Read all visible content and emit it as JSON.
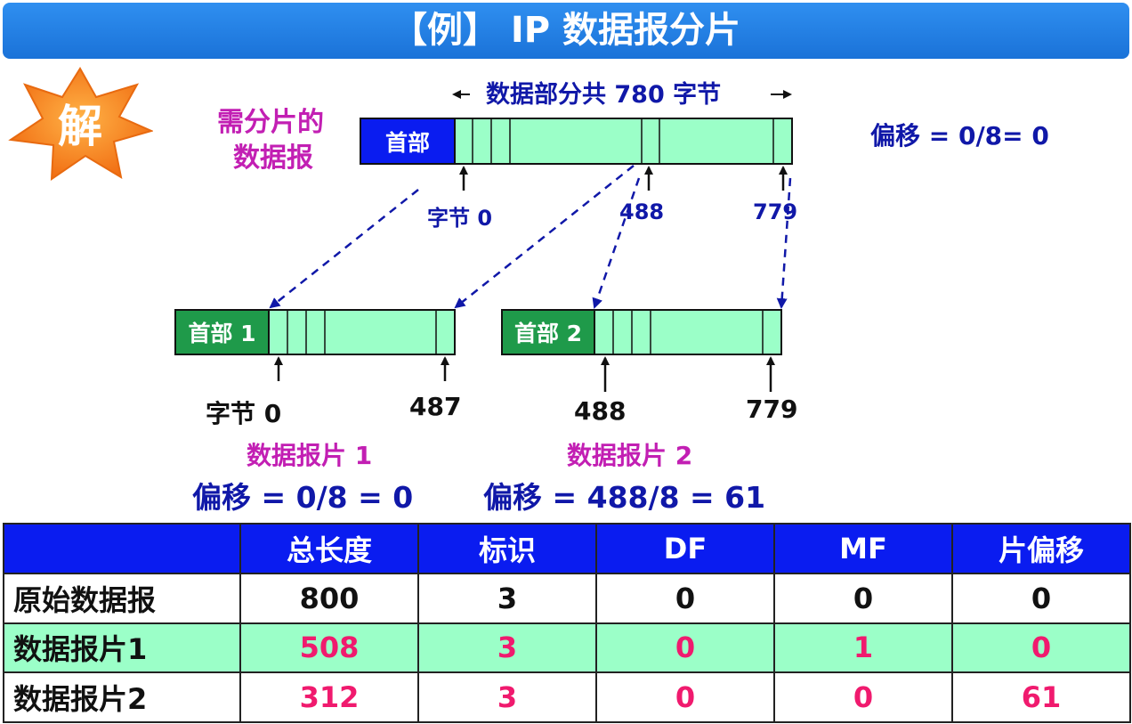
{
  "title": "【例】 IP 数据报分片",
  "solve_badge": "解",
  "original": {
    "caption_line1": "需分片的",
    "caption_line2": "数据报",
    "header_label": "首部",
    "data_span": "数据部分共 780 字节",
    "offset_text": "偏移 = 0/8= 0",
    "marks": [
      "字节 0",
      "488",
      "779"
    ]
  },
  "fragment1": {
    "header_label": "首部 1",
    "marks": [
      "字节 0",
      "487"
    ],
    "caption": "数据报片 1",
    "offset_text": "偏移 = 0/8 = 0"
  },
  "fragment2": {
    "header_label": "首部 2",
    "marks": [
      "488",
      "779"
    ],
    "caption": "数据报片 2",
    "offset_text": "偏移 = 488/8 = 61"
  },
  "table": {
    "headers": [
      "",
      "总长度",
      "标识",
      "DF",
      "MF",
      "片偏移"
    ],
    "rows": [
      {
        "label": "原始数据报",
        "values": [
          "800",
          "3",
          "0",
          "0",
          "0"
        ]
      },
      {
        "label": "数据报片1",
        "values": [
          "508",
          "3",
          "0",
          "1",
          "0"
        ]
      },
      {
        "label": "数据报片2",
        "values": [
          "312",
          "3",
          "0",
          "0",
          "61"
        ]
      }
    ]
  },
  "colors": {
    "title_bar": "#1a72d8",
    "header_blue": "#0a1cf0",
    "header_green": "#1f9a4a",
    "data_fill": "#9bffc8",
    "magenta": "#c21fb3",
    "navy": "#1018a8",
    "pink": "#f01a6e"
  }
}
